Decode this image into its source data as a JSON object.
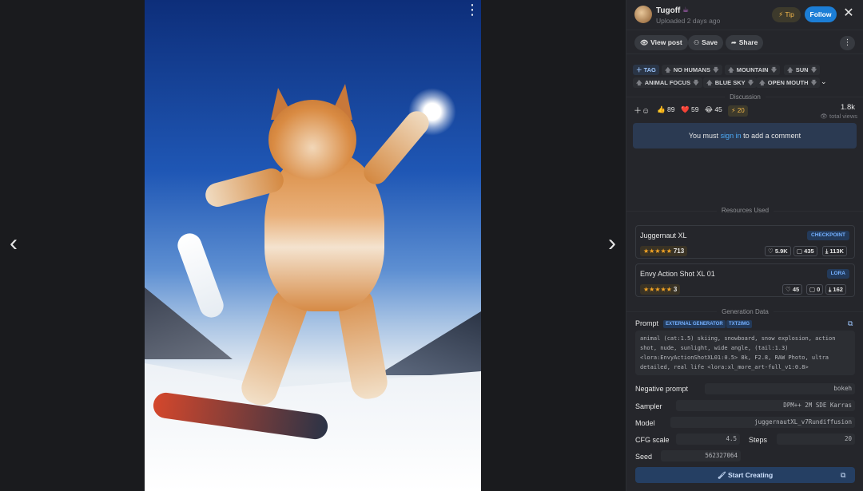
{
  "viewer": {
    "menu_icon": "⋮",
    "prev_icon": "‹",
    "next_icon": "›"
  },
  "header": {
    "username": "Tugoff",
    "badge_icon": "☕",
    "uploaded": "Uploaded 2 days ago",
    "tip_label": "⚡ Tip",
    "follow_label": "Follow",
    "close_icon": "✕"
  },
  "actions": {
    "view_post": "View post",
    "save": "Save",
    "share": "Share",
    "more_icon": "⋮"
  },
  "tags": {
    "add_label": "TAG",
    "items": [
      "no humans",
      "mountain",
      "sun",
      "animal focus",
      "blue sky",
      "open mouth"
    ],
    "expand_icon": "⌄"
  },
  "discussion": {
    "label": "Discussion",
    "reactions": [
      {
        "icon": "👍",
        "count": "89"
      },
      {
        "icon": "❤️",
        "count": "59"
      },
      {
        "icon": "😂",
        "count": "45"
      }
    ],
    "buzz": "⚡ 20",
    "views_count": "1.8k",
    "views_label": "total views",
    "signin_pre": "You must ",
    "signin_link": "sign in",
    "signin_post": " to add a comment"
  },
  "resources": {
    "label": "Resources Used",
    "items": [
      {
        "name": "Juggernaut XL",
        "type": "CHECKPOINT",
        "stars": "★★★★★",
        "rating_count": "713",
        "likes": "5.9K",
        "comments": "435",
        "downloads": "113K"
      },
      {
        "name": "Envy Action Shot XL 01",
        "type": "LORA",
        "stars": "★★★★★",
        "rating_count": "3",
        "likes": "45",
        "comments": "0",
        "downloads": "162"
      }
    ]
  },
  "generation": {
    "label": "Generation Data",
    "prompt_label": "Prompt",
    "badge_external": "EXTERNAL GENERATOR",
    "badge_txt2img": "TXT2IMG",
    "prompt_text": "animal (cat:1.5) skiing, snowboard, snow explosion, action shot, nude, sunlight, wide angle, (tail:1.3) <lora:EnvyActionShotXL01:0.5> 8k, F2.8, RAW Photo, ultra detailed, real life <lora:xl_more_art-full_v1:0.8>",
    "negative_label": "Negative prompt",
    "negative_value": "bokeh",
    "sampler_label": "Sampler",
    "sampler_value": "DPM++ 2M SDE Karras",
    "model_label": "Model",
    "model_value": "juggernautXL_v7Rundiffusion",
    "cfg_label": "CFG scale",
    "cfg_value": "4.5",
    "steps_label": "Steps",
    "steps_value": "20",
    "seed_label": "Seed",
    "seed_value": "562327064",
    "start_label": "Start Creating"
  }
}
